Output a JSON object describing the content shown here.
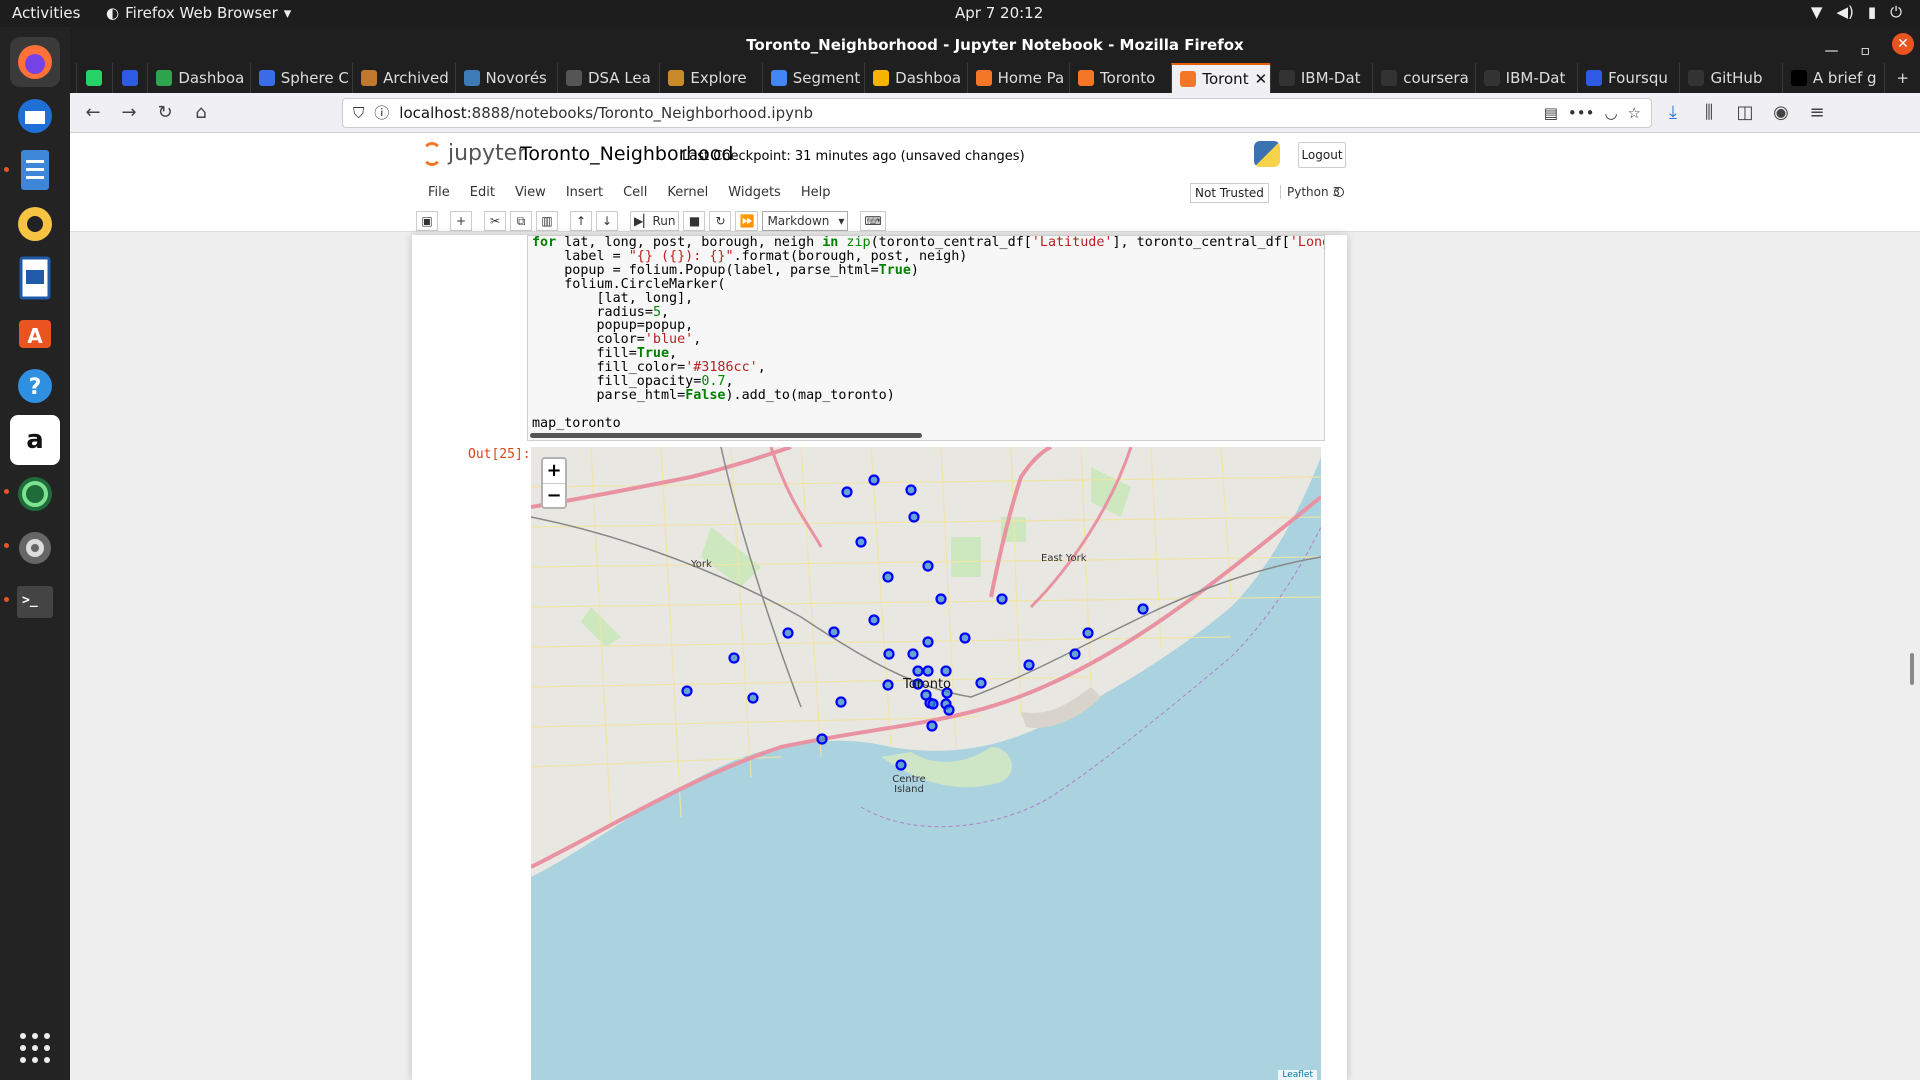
{
  "topbar": {
    "activities": "Activities",
    "app_name": "Firefox Web Browser",
    "clock": "Apr 7  20:12"
  },
  "window": {
    "title": "Toronto_Neighborhood - Jupyter Notebook - Mozilla Firefox"
  },
  "tabs": [
    {
      "label": "",
      "icon": "whatsapp-icon",
      "color": "#25d366",
      "pinned": true
    },
    {
      "label": "",
      "icon": "foursquare-icon",
      "color": "#2d5be3",
      "pinned": true
    },
    {
      "label": "Dashboa",
      "icon": "h-icon",
      "color": "#2fa44f"
    },
    {
      "label": "Sphere C",
      "icon": "sphere-icon",
      "color": "#3a6ee8"
    },
    {
      "label": "Archived",
      "icon": "archive-icon",
      "color": "#c07830"
    },
    {
      "label": "Novorés",
      "icon": "n-icon",
      "color": "#3d7ab8"
    },
    {
      "label": "DSA Lea",
      "icon": "cs-icon",
      "color": "#555555"
    },
    {
      "label": "Explore",
      "icon": "explore-icon",
      "color": "#c98a2b"
    },
    {
      "label": "Segment",
      "icon": "link-icon",
      "color": "#4285f4"
    },
    {
      "label": "Dashboa",
      "icon": "bar-icon",
      "color": "#f4b400"
    },
    {
      "label": "Home Pa",
      "icon": "jupyter-icon",
      "color": "#f37726"
    },
    {
      "label": "Toronto",
      "icon": "notebook-icon",
      "color": "#f37726"
    },
    {
      "label": "Toront",
      "icon": "notebook-icon",
      "color": "#f37726",
      "active": true
    },
    {
      "label": "IBM-Dat",
      "icon": "github-icon",
      "color": "#333333"
    },
    {
      "label": "coursera",
      "icon": "github-icon",
      "color": "#333333"
    },
    {
      "label": "IBM-Dat",
      "icon": "github-icon",
      "color": "#333333"
    },
    {
      "label": "Foursqu",
      "icon": "foursquare-icon",
      "color": "#2d5be3"
    },
    {
      "label": "GitHub",
      "icon": "github-icon",
      "color": "#333333"
    },
    {
      "label": "A brief g",
      "icon": "medium-icon",
      "color": "#000000"
    }
  ],
  "navbar": {
    "url_host": "localhost",
    "url_rest": ":8888/notebooks/Toronto_Neighborhood.ipynb"
  },
  "jupyter": {
    "logo_text": "jupyter",
    "notebook_name": "Toronto_Neighborhood",
    "checkpoint": "Last Checkpoint: 31 minutes ago   (unsaved changes)",
    "logout": "Logout",
    "menus": [
      "File",
      "Edit",
      "View",
      "Insert",
      "Cell",
      "Kernel",
      "Widgets",
      "Help"
    ],
    "trust": "Not Trusted",
    "kernel": "Python 3",
    "run_label": "Run",
    "cell_type": "Markdown"
  },
  "cell": {
    "out_prompt": "Out[25]:"
  },
  "map": {
    "city_label": "Toronto",
    "labels": [
      "York",
      "East York",
      "Centre Island"
    ],
    "attribution": "Leaflet",
    "zoom_in": "+",
    "zoom_out": "−",
    "marker_color": "#3186cc",
    "marker_stroke": "blue"
  }
}
